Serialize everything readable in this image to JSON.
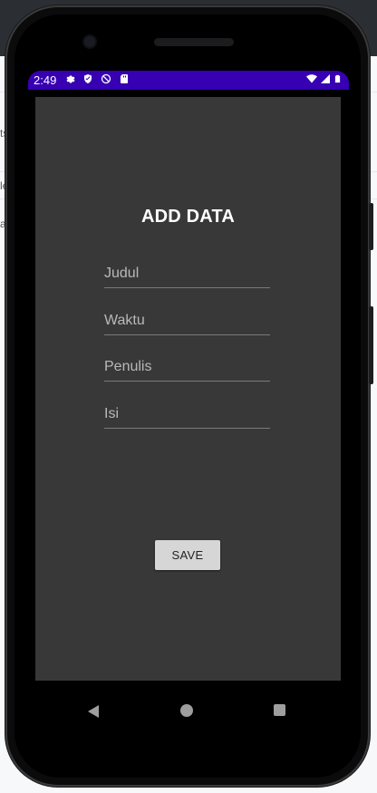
{
  "status_bar": {
    "time": "2:49",
    "color": "#3700b3",
    "left_icons": [
      "settings-icon",
      "shield-icon",
      "do-not-disturb-icon",
      "sd-card-icon"
    ],
    "right_icons": [
      "wifi-icon",
      "signal-icon",
      "battery-icon"
    ]
  },
  "screen": {
    "title": "ADD DATA",
    "fields": [
      {
        "placeholder": "Judul",
        "value": ""
      },
      {
        "placeholder": "Waktu",
        "value": ""
      },
      {
        "placeholder": "Penulis",
        "value": ""
      },
      {
        "placeholder": "Isi",
        "value": ""
      }
    ],
    "save_label": "SAVE"
  },
  "nav_bar": {
    "icons": [
      "back-icon",
      "home-icon",
      "recents-icon"
    ]
  },
  "background_text": [
    "ts:",
    "le",
    "at"
  ]
}
